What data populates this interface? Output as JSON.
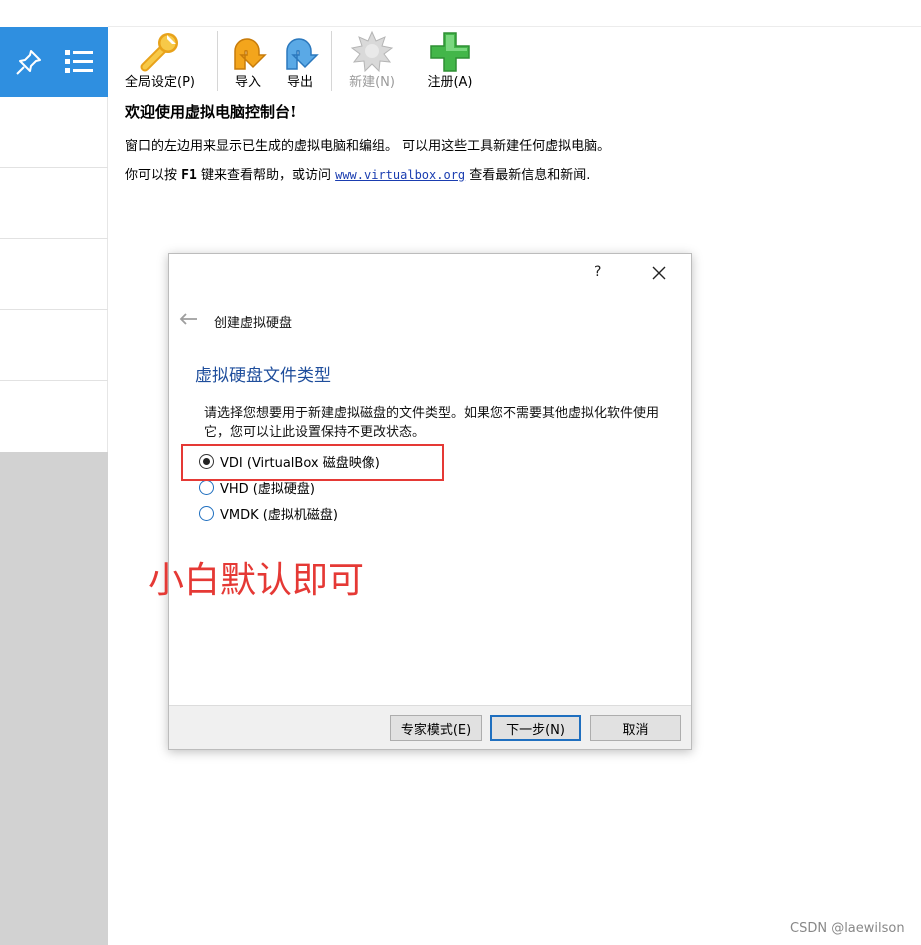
{
  "toolbar": {
    "global_settings_label": "全局设定(P)",
    "import_label": "导入",
    "export_label": "导出",
    "new_label": "新建(N)",
    "register_label": "注册(A)"
  },
  "welcome": {
    "title": "欢迎使用虚拟电脑控制台!",
    "line1": "窗口的左边用来显示已生成的虚拟电脑和编组。 可以用这些工具新建任何虚拟电脑。",
    "line2_prefix": "你可以按",
    "line2_key": "F1",
    "line2_mid": "键来查看帮助，或访问",
    "line2_link": "www.virtualbox.org",
    "line2_suffix": "查看最新信息和新闻."
  },
  "dialog": {
    "help_symbol": "?",
    "title": "创建虚拟硬盘",
    "heading": "虚拟硬盘文件类型",
    "description": "请选择您想要用于新建虚拟磁盘的文件类型。如果您不需要其他虚拟化软件使用它，您可以让此设置保持不更改状态。",
    "options": [
      {
        "label": "VDI (VirtualBox 磁盘映像)",
        "checked": true
      },
      {
        "label": "VHD (虚拟硬盘)",
        "checked": false
      },
      {
        "label": "VMDK (虚拟机磁盘)",
        "checked": false
      }
    ],
    "annotation": "小白默认即可",
    "buttons": {
      "expert": "专家模式(E)",
      "next": "下一步(N)",
      "cancel": "取消"
    }
  },
  "watermark": "CSDN @laewilson",
  "colors": {
    "sidebar_accent": "#2f8fe0",
    "annotation_red": "#e53935",
    "heading_blue": "#1f4e9c",
    "link_blue": "#1a3db0"
  }
}
